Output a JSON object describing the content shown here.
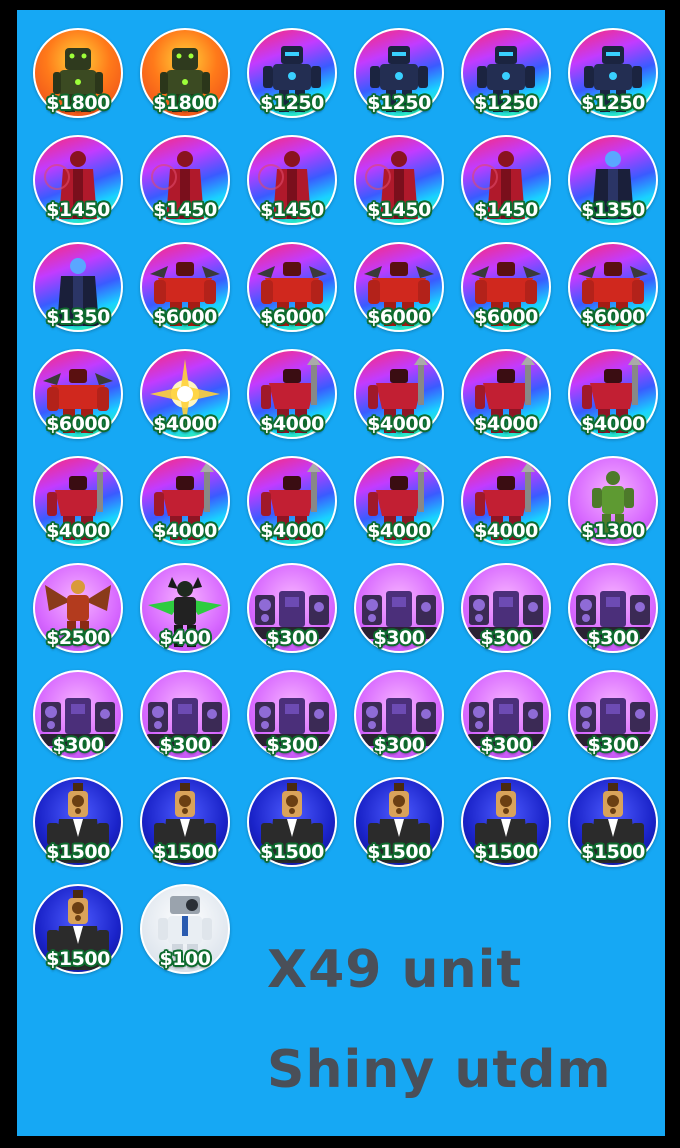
{
  "units": [
    {
      "price": "$1800",
      "icon": "green-mech-unit-icon",
      "bg": "orange"
    },
    {
      "price": "$1800",
      "icon": "green-mech-unit-icon",
      "bg": "orange"
    },
    {
      "price": "$1250",
      "icon": "blue-titan-unit-icon",
      "bg": "rainbow"
    },
    {
      "price": "$1250",
      "icon": "blue-titan-unit-icon",
      "bg": "rainbow"
    },
    {
      "price": "$1250",
      "icon": "blue-titan-unit-icon",
      "bg": "rainbow"
    },
    {
      "price": "$1250",
      "icon": "blue-titan-unit-icon",
      "bg": "rainbow"
    },
    {
      "price": "$1450",
      "icon": "red-coat-unit-icon",
      "bg": "rainbow"
    },
    {
      "price": "$1450",
      "icon": "red-coat-unit-icon",
      "bg": "rainbow"
    },
    {
      "price": "$1450",
      "icon": "red-coat-unit-icon",
      "bg": "rainbow"
    },
    {
      "price": "$1450",
      "icon": "red-coat-unit-icon",
      "bg": "rainbow"
    },
    {
      "price": "$1450",
      "icon": "red-coat-unit-icon",
      "bg": "rainbow"
    },
    {
      "price": "$1350",
      "icon": "dark-cloak-unit-icon",
      "bg": "rainbow"
    },
    {
      "price": "$1350",
      "icon": "dark-cloak-unit-icon",
      "bg": "rainbow"
    },
    {
      "price": "$6000",
      "icon": "red-spiked-titan-unit-icon",
      "bg": "rainbow"
    },
    {
      "price": "$6000",
      "icon": "red-spiked-titan-unit-icon",
      "bg": "rainbow"
    },
    {
      "price": "$6000",
      "icon": "red-spiked-titan-unit-icon",
      "bg": "rainbow"
    },
    {
      "price": "$6000",
      "icon": "red-spiked-titan-unit-icon",
      "bg": "rainbow"
    },
    {
      "price": "$6000",
      "icon": "red-spiked-titan-unit-icon",
      "bg": "rainbow"
    },
    {
      "price": "$6000",
      "icon": "red-spiked-titan-unit-icon",
      "bg": "rainbow"
    },
    {
      "price": "$4000",
      "icon": "golden-burst-unit-icon",
      "bg": "rainbow"
    },
    {
      "price": "$4000",
      "icon": "red-drill-titan-unit-icon",
      "bg": "rainbow"
    },
    {
      "price": "$4000",
      "icon": "red-drill-titan-unit-icon",
      "bg": "rainbow"
    },
    {
      "price": "$4000",
      "icon": "red-drill-titan-unit-icon",
      "bg": "rainbow"
    },
    {
      "price": "$4000",
      "icon": "red-drill-titan-unit-icon",
      "bg": "rainbow"
    },
    {
      "price": "$4000",
      "icon": "red-drill-titan-unit-icon",
      "bg": "rainbow"
    },
    {
      "price": "$4000",
      "icon": "red-drill-titan-unit-icon",
      "bg": "rainbow"
    },
    {
      "price": "$4000",
      "icon": "red-drill-titan-unit-icon",
      "bg": "rainbow"
    },
    {
      "price": "$4000",
      "icon": "red-drill-titan-unit-icon",
      "bg": "rainbow"
    },
    {
      "price": "$4000",
      "icon": "red-drill-titan-unit-icon",
      "bg": "rainbow"
    },
    {
      "price": "$1300",
      "icon": "green-soldier-unit-icon",
      "bg": "pink"
    },
    {
      "price": "$2500",
      "icon": "winged-golden-unit-icon",
      "bg": "pink"
    },
    {
      "price": "$400",
      "icon": "green-demon-unit-icon",
      "bg": "pink"
    },
    {
      "price": "$300",
      "icon": "speaker-tower-unit-icon",
      "bg": "pink"
    },
    {
      "price": "$300",
      "icon": "speaker-tower-unit-icon",
      "bg": "pink"
    },
    {
      "price": "$300",
      "icon": "speaker-tower-unit-icon",
      "bg": "pink"
    },
    {
      "price": "$300",
      "icon": "speaker-tower-unit-icon",
      "bg": "pink"
    },
    {
      "price": "$300",
      "icon": "speaker-tower-unit-icon",
      "bg": "pink"
    },
    {
      "price": "$300",
      "icon": "speaker-tower-unit-icon",
      "bg": "pink"
    },
    {
      "price": "$300",
      "icon": "speaker-tower-unit-icon",
      "bg": "pink"
    },
    {
      "price": "$300",
      "icon": "speaker-tower-unit-icon",
      "bg": "pink"
    },
    {
      "price": "$300",
      "icon": "speaker-tower-unit-icon",
      "bg": "pink"
    },
    {
      "price": "$300",
      "icon": "speaker-tower-unit-icon",
      "bg": "pink"
    },
    {
      "price": "$1500",
      "icon": "speakerman-suit-unit-icon",
      "bg": "blue"
    },
    {
      "price": "$1500",
      "icon": "speakerman-suit-unit-icon",
      "bg": "blue"
    },
    {
      "price": "$1500",
      "icon": "speakerman-suit-unit-icon",
      "bg": "blue"
    },
    {
      "price": "$1500",
      "icon": "speakerman-suit-unit-icon",
      "bg": "blue"
    },
    {
      "price": "$1500",
      "icon": "speakerman-suit-unit-icon",
      "bg": "blue"
    },
    {
      "price": "$1500",
      "icon": "speakerman-suit-unit-icon",
      "bg": "blue"
    },
    {
      "price": "$1500",
      "icon": "speakerman-suit-unit-icon",
      "bg": "blue"
    },
    {
      "price": "$100",
      "icon": "cameraman-unit-icon",
      "bg": "white"
    }
  ],
  "caption": {
    "count": "X49 unit",
    "shiny": "Shiny utdm"
  },
  "colors": {
    "background": "#16a8f4",
    "price_outline": "#0e6b2e",
    "caption_text": "#4a4f58"
  }
}
